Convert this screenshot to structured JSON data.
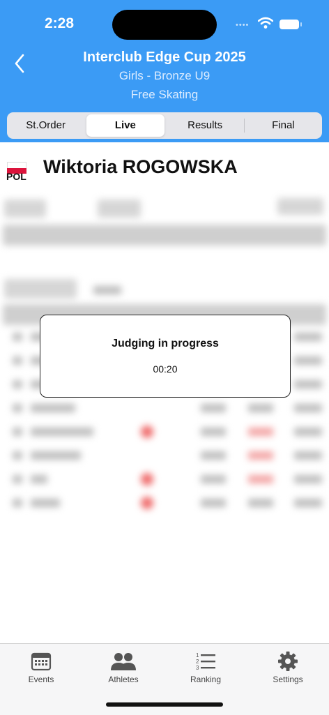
{
  "status": {
    "time": "2:28"
  },
  "header": {
    "title": "Interclub Edge Cup 2025",
    "category": "Girls - Bronze U9",
    "segment": "Free Skating"
  },
  "tabs": [
    {
      "label": "St.Order",
      "active": false
    },
    {
      "label": "Live",
      "active": true
    },
    {
      "label": "Results",
      "active": false
    },
    {
      "label": "Final",
      "active": false
    }
  ],
  "athlete": {
    "country": "POL",
    "name": "Wiktoria ROGOWSKA"
  },
  "modal": {
    "title": "Judging in progress",
    "timer": "00:20"
  },
  "tabbar": [
    {
      "label": "Events",
      "icon": "calendar-icon"
    },
    {
      "label": "Athletes",
      "icon": "people-icon"
    },
    {
      "label": "Ranking",
      "icon": "ranking-list-icon"
    },
    {
      "label": "Settings",
      "icon": "gear-icon"
    }
  ],
  "colors": {
    "header_bg": "#3b9bf5",
    "flag_red": "#dc143c"
  }
}
